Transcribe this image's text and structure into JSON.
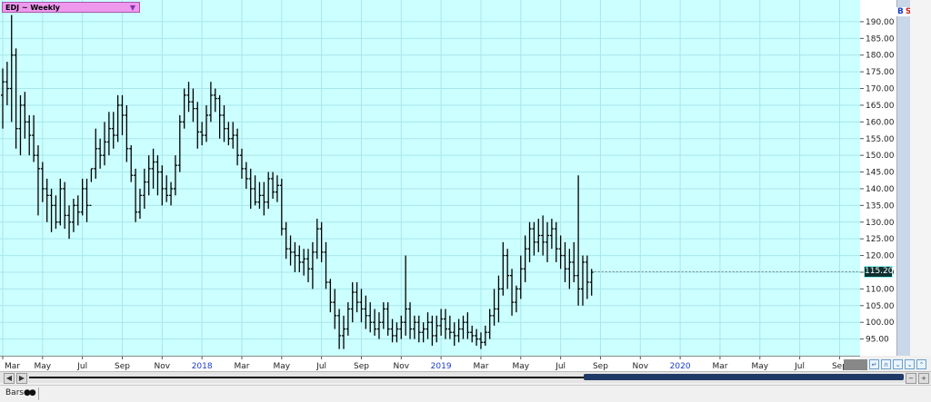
{
  "header": {
    "symbol_label": "EDJ ~ Weekly",
    "dropdown_icon": "triangle-down-icon"
  },
  "side_strip": {
    "b_label": "B",
    "s_label": "S"
  },
  "last_price_label": "115.20",
  "colors": {
    "plot_bg": "#ccffff",
    "grid": "#a8e6ec",
    "bars": "#000000",
    "year_label": "#1a3ccc",
    "price_tag_bg": "#0f3030"
  },
  "status": {
    "chart_type_label": "Bars",
    "chart_type_icon": "bars-icon"
  },
  "chart_data": {
    "type": "ohlc",
    "title": "EDJ ~ Weekly",
    "xlabel": "",
    "ylabel": "",
    "ylim": [
      90,
      196.5
    ],
    "yticks": [
      95,
      100,
      105,
      110,
      115,
      120,
      125,
      130,
      135,
      140,
      145,
      150,
      155,
      160,
      165,
      170,
      175,
      180,
      185,
      190
    ],
    "grid": true,
    "x_tick_labels": [
      {
        "label": "Mar",
        "week": 0,
        "year": false
      },
      {
        "label": "May",
        "week": 9,
        "year": false
      },
      {
        "label": "Jul",
        "week": 18,
        "year": false
      },
      {
        "label": "Sep",
        "week": 27,
        "year": false
      },
      {
        "label": "Nov",
        "week": 36,
        "year": false
      },
      {
        "label": "2018",
        "week": 45,
        "year": true
      },
      {
        "label": "Mar",
        "week": 54,
        "year": false
      },
      {
        "label": "May",
        "week": 63,
        "year": false
      },
      {
        "label": "Jul",
        "week": 72,
        "year": false
      },
      {
        "label": "Sep",
        "week": 81,
        "year": false
      },
      {
        "label": "Nov",
        "week": 90,
        "year": false
      },
      {
        "label": "2019",
        "week": 99,
        "year": true
      },
      {
        "label": "Mar",
        "week": 108,
        "year": false
      },
      {
        "label": "May",
        "week": 117,
        "year": false
      },
      {
        "label": "Jul",
        "week": 126,
        "year": false
      },
      {
        "label": "Sep",
        "week": 135,
        "year": false
      },
      {
        "label": "Nov",
        "week": 144,
        "year": false
      },
      {
        "label": "2020",
        "week": 153,
        "year": true
      },
      {
        "label": "Mar",
        "week": 162,
        "year": false
      },
      {
        "label": "May",
        "week": 171,
        "year": false
      },
      {
        "label": "Jul",
        "week": 180,
        "year": false
      },
      {
        "label": "Sep",
        "week": 189,
        "year": false
      }
    ],
    "last_price": 115.2,
    "bars": [
      [
        168,
        176,
        158,
        172
      ],
      [
        172,
        178,
        165,
        170
      ],
      [
        170,
        192,
        160,
        180
      ],
      [
        180,
        182,
        152,
        158
      ],
      [
        158,
        168,
        150,
        165
      ],
      [
        165,
        169,
        155,
        160
      ],
      [
        160,
        162,
        150,
        156
      ],
      [
        156,
        162,
        148,
        150
      ],
      [
        150,
        153,
        132,
        146
      ],
      [
        146,
        148,
        136,
        140
      ],
      [
        140,
        143,
        130,
        138
      ],
      [
        138,
        140,
        127,
        135
      ],
      [
        135,
        138,
        128,
        130
      ],
      [
        130,
        143,
        129,
        140
      ],
      [
        140,
        142,
        128,
        132
      ],
      [
        132,
        135,
        125,
        130
      ],
      [
        130,
        137,
        127,
        135
      ],
      [
        135,
        138,
        129,
        133
      ],
      [
        133,
        143,
        132,
        140
      ],
      [
        140,
        143,
        130,
        135
      ],
      [
        135,
        146,
        142,
        146
      ],
      [
        146,
        158,
        143,
        152
      ],
      [
        152,
        155,
        146,
        150
      ],
      [
        150,
        160,
        147,
        154
      ],
      [
        154,
        163,
        150,
        158
      ],
      [
        158,
        163,
        152,
        156
      ],
      [
        156,
        168,
        154,
        165
      ],
      [
        165,
        168,
        156,
        162
      ],
      [
        162,
        165,
        148,
        152
      ],
      [
        152,
        153,
        142,
        144
      ],
      [
        144,
        146,
        130,
        133
      ],
      [
        133,
        140,
        131,
        138
      ],
      [
        138,
        146,
        134,
        142
      ],
      [
        142,
        150,
        138,
        146
      ],
      [
        146,
        152,
        140,
        148
      ],
      [
        148,
        150,
        138,
        145
      ],
      [
        145,
        147,
        135,
        140
      ],
      [
        140,
        144,
        136,
        138
      ],
      [
        138,
        142,
        135,
        140
      ],
      [
        140,
        150,
        138,
        147
      ],
      [
        147,
        162,
        145,
        160
      ],
      [
        160,
        170,
        158,
        168
      ],
      [
        168,
        172,
        163,
        166
      ],
      [
        166,
        170,
        160,
        164
      ],
      [
        164,
        166,
        152,
        157
      ],
      [
        157,
        160,
        153,
        156
      ],
      [
        156,
        165,
        154,
        162
      ],
      [
        162,
        172,
        160,
        168
      ],
      [
        168,
        170,
        163,
        167
      ],
      [
        167,
        168,
        155,
        162
      ],
      [
        162,
        165,
        154,
        158
      ],
      [
        158,
        160,
        153,
        155
      ],
      [
        155,
        160,
        152,
        156
      ],
      [
        156,
        158,
        147,
        150
      ],
      [
        150,
        152,
        143,
        146
      ],
      [
        146,
        148,
        140,
        143
      ],
      [
        143,
        146,
        134,
        140
      ],
      [
        140,
        144,
        135,
        136
      ],
      [
        136,
        142,
        134,
        138
      ],
      [
        138,
        142,
        132,
        136
      ],
      [
        136,
        145,
        134,
        143
      ],
      [
        143,
        145,
        137,
        139
      ],
      [
        139,
        144,
        136,
        141
      ],
      [
        141,
        143,
        126,
        128
      ],
      [
        128,
        130,
        119,
        122
      ],
      [
        122,
        126,
        117,
        121
      ],
      [
        121,
        124,
        115,
        120
      ],
      [
        120,
        123,
        115,
        118
      ],
      [
        118,
        122,
        114,
        119
      ],
      [
        119,
        122,
        112,
        116
      ],
      [
        116,
        124,
        110,
        121
      ],
      [
        121,
        131,
        119,
        128
      ],
      [
        128,
        130,
        118,
        121
      ],
      [
        121,
        124,
        110,
        112
      ],
      [
        112,
        113,
        103,
        106
      ],
      [
        106,
        110,
        98,
        102
      ],
      [
        102,
        104,
        92,
        96
      ],
      [
        96,
        102,
        92,
        98
      ],
      [
        98,
        106,
        96,
        104
      ],
      [
        104,
        112,
        100,
        109
      ],
      [
        109,
        112,
        103,
        106
      ],
      [
        106,
        110,
        100,
        104
      ],
      [
        104,
        108,
        98,
        102
      ],
      [
        102,
        106,
        97,
        100
      ],
      [
        100,
        104,
        96,
        98
      ],
      [
        98,
        103,
        95,
        100
      ],
      [
        100,
        106,
        98,
        104
      ],
      [
        104,
        106,
        96,
        98
      ],
      [
        98,
        101,
        94,
        96
      ],
      [
        96,
        100,
        94,
        98
      ],
      [
        98,
        102,
        95,
        100
      ],
      [
        100,
        120,
        96,
        104
      ],
      [
        104,
        106,
        95,
        98
      ],
      [
        98,
        102,
        95,
        100
      ],
      [
        100,
        102,
        94,
        97
      ],
      [
        97,
        100,
        94,
        98
      ],
      [
        98,
        103,
        95,
        100
      ],
      [
        100,
        102,
        93,
        96
      ],
      [
        96,
        102,
        94,
        99
      ],
      [
        99,
        104,
        96,
        101
      ],
      [
        101,
        104,
        95,
        98
      ],
      [
        98,
        102,
        95,
        97
      ],
      [
        97,
        100,
        93,
        96
      ],
      [
        96,
        101,
        94,
        98
      ],
      [
        98,
        102,
        95,
        100
      ],
      [
        100,
        103,
        95,
        97
      ],
      [
        97,
        99,
        94,
        96
      ],
      [
        96,
        98,
        93,
        95
      ],
      [
        95,
        97,
        92,
        94
      ],
      [
        94,
        99,
        93,
        97
      ],
      [
        97,
        104,
        95,
        102
      ],
      [
        102,
        110,
        99,
        104
      ],
      [
        104,
        114,
        100,
        110
      ],
      [
        110,
        124,
        108,
        120
      ],
      [
        120,
        122,
        110,
        114
      ],
      [
        114,
        116,
        102,
        106
      ],
      [
        106,
        111,
        103,
        110
      ],
      [
        110,
        120,
        107,
        116
      ],
      [
        116,
        126,
        112,
        122
      ],
      [
        122,
        130,
        118,
        128
      ],
      [
        128,
        130,
        120,
        124
      ],
      [
        124,
        131,
        121,
        126
      ],
      [
        126,
        132,
        120,
        124
      ],
      [
        124,
        130,
        118,
        126
      ],
      [
        126,
        131,
        122,
        128
      ],
      [
        128,
        130,
        118,
        122
      ],
      [
        122,
        126,
        116,
        120
      ],
      [
        120,
        124,
        112,
        116
      ],
      [
        116,
        122,
        110,
        118
      ],
      [
        118,
        124,
        112,
        114
      ],
      [
        114,
        144,
        105,
        110
      ],
      [
        110,
        120,
        105,
        118
      ],
      [
        118,
        120,
        107,
        112
      ],
      [
        112,
        116,
        108,
        115
      ]
    ]
  }
}
